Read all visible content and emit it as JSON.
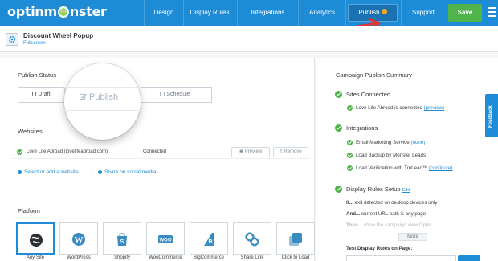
{
  "nav": {
    "logo": "optinmonster",
    "items": [
      "Design",
      "Display Rules",
      "Integrations",
      "Analytics",
      "Publish",
      "Support"
    ],
    "save_label": "Save"
  },
  "campaign": {
    "title": "Discount Wheel Popup",
    "type": "Fullscreen"
  },
  "publish_status": {
    "title": "Publish Status",
    "tabs": [
      "Draft",
      "Publish",
      "Schedule"
    ]
  },
  "websites": {
    "title": "Websites",
    "site_name": "Love Life Abroad (lovelifeabroad.com)",
    "status": "Connected",
    "preview_label": "Preview",
    "remove_label": "Remove",
    "add_link": "Select or add a website",
    "separator": "|",
    "share_link": "Share on social media"
  },
  "platform": {
    "title": "Platform",
    "items": [
      "Any Site",
      "WordPress",
      "Shopify",
      "WooCommerce",
      "BigCommerce",
      "Share Link",
      "Click to Load"
    ]
  },
  "summary": {
    "title": "Campaign Publish Summary",
    "sites_connected": {
      "title": "Sites Connected",
      "line_text": "Love Life Abroad is connected",
      "line_link": "(preview)"
    },
    "integrations": {
      "title": "Integrations",
      "email_text": "Email Marketing Service",
      "email_link": "(none)",
      "backup": "Load Backup by Monster Leads",
      "trulead_text": "Load Verification with TruLead™",
      "trulead_link": "(configure)"
    },
    "display_rules": {
      "title": "Display Rules Setup",
      "edit_label": "Edit",
      "line1_bold": "If...",
      "line1": " exit detected on desktop devices only",
      "line2_bold": "And...",
      "line2": " current URL path is any page",
      "line3_bold": "Then...",
      "line3": " show the campaign view Optin",
      "more_label": "More"
    },
    "test_label": "Test Display Rules on Page:"
  },
  "feedback_label": "Feedback",
  "colors": {
    "nav_blue": "#1e8bd6",
    "save_green": "#4fb44b",
    "arrow_red": "#e8312f",
    "publish_dot": "#f6a623"
  }
}
